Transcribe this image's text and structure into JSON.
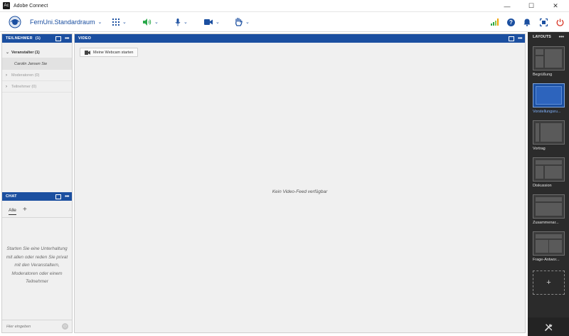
{
  "window": {
    "title": "Adobe Connect",
    "minimize": "—",
    "maximize": "☐",
    "close": "✕"
  },
  "toolbar": {
    "room_name": "FernUni.Standardraum",
    "chevron": "⌄",
    "apps_icon": "apps-grid-icon",
    "speaker_icon": "speaker-icon",
    "mic_icon": "microphone-icon",
    "camera_icon": "camera-icon",
    "hand_icon": "raise-hand-icon",
    "help": "?",
    "accent": "#1b4fa0",
    "speaker_color": "#2aa84a",
    "power_color": "#d93a2b"
  },
  "attendees": {
    "title": "TEILNEHMER",
    "count": "(1)",
    "rows": [
      {
        "arrow": "⌄",
        "label": "Veranstalter (1)"
      },
      {
        "arrow": "",
        "label": "Carolin Jansen  Sie"
      },
      {
        "arrow": "›",
        "label": "Moderatoren (0)"
      },
      {
        "arrow": "›",
        "label": "Teilnehmer (0)"
      }
    ]
  },
  "chat": {
    "title": "CHAT",
    "tab_all": "Alle",
    "add_tab": "+",
    "empty_message": "Starten Sie eine Unterhaltung mit allen oder reden Sie privat mit den Veranstaltern, Moderatoren oder einem Teilnehmer",
    "input_placeholder": "Hier eingeben",
    "emoji": "☺"
  },
  "video": {
    "title": "VIDEO",
    "webcam_button": "Meine Webcam starten",
    "empty_message": "Kein Video-Feed verfügbar"
  },
  "layouts": {
    "title": "LAYOUTS",
    "items": [
      {
        "label": "Begrüßung",
        "selected": false
      },
      {
        "label": "Vorstellungsru...",
        "selected": true
      },
      {
        "label": "Vortrag",
        "selected": false
      },
      {
        "label": "Diskussion",
        "selected": false
      },
      {
        "label": "Zusammenar...",
        "selected": false
      },
      {
        "label": "Frage-Antwor...",
        "selected": false
      }
    ],
    "add": "+",
    "settings_icon": "tools-icon"
  }
}
